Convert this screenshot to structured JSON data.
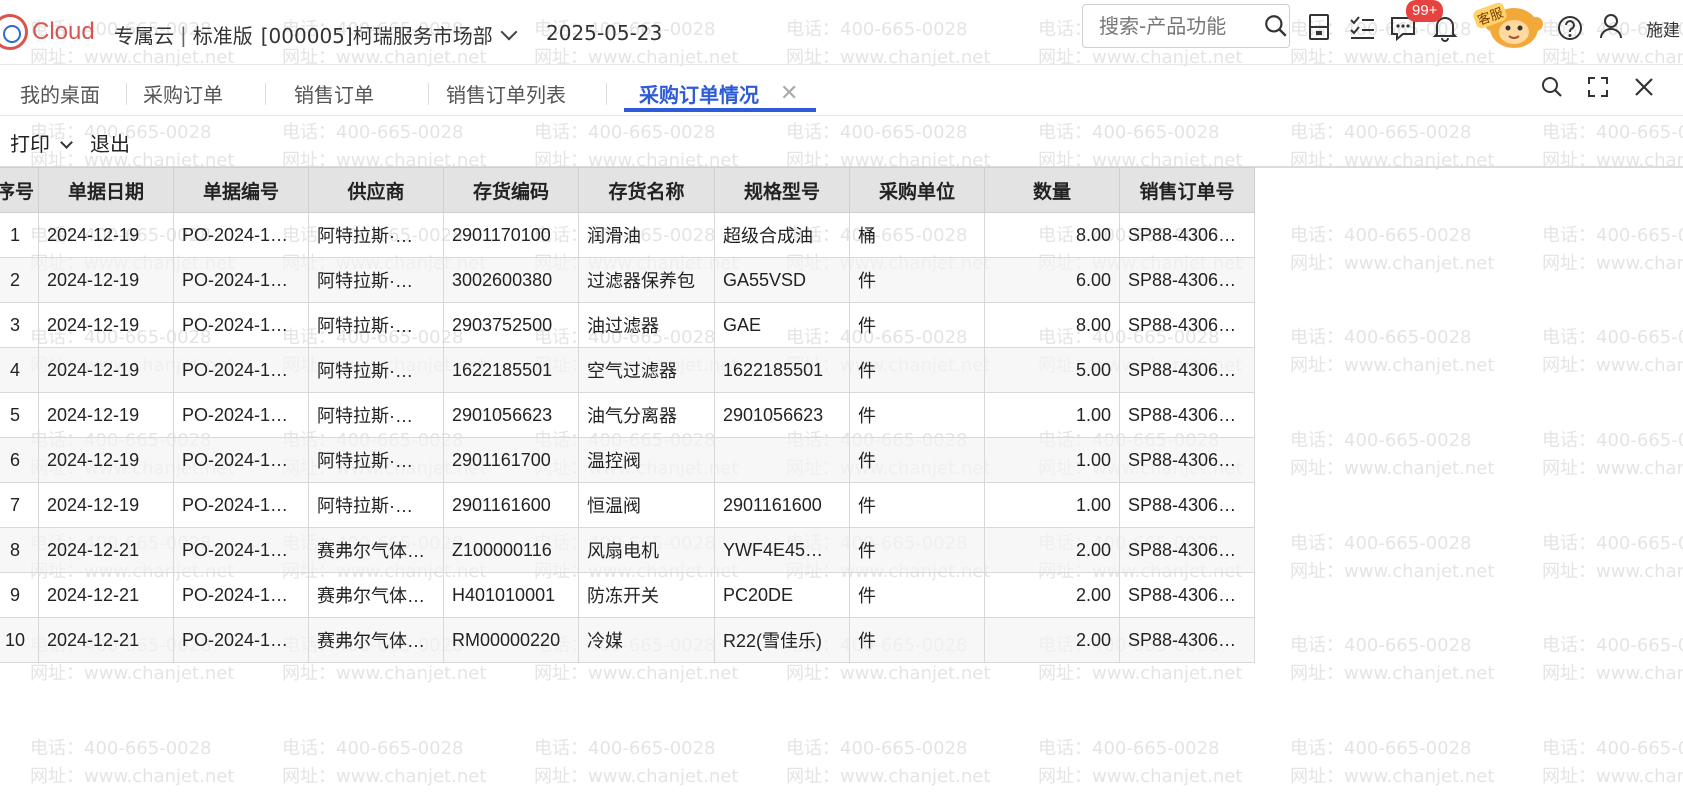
{
  "header": {
    "logo_text": "Cloud",
    "product": "专属云",
    "edition": "标准版",
    "org": "[000005]柯瑞服务市场部",
    "date": "2025-05-23",
    "search_placeholder": "搜索-产品功能",
    "badge": "99+",
    "kefu_label": "客服",
    "username": "施建"
  },
  "tabs": [
    {
      "label": "我的桌面"
    },
    {
      "label": "采购订单"
    },
    {
      "label": "销售订单"
    },
    {
      "label": "销售订单列表"
    },
    {
      "label": "采购订单情况"
    }
  ],
  "toolbar": {
    "print": "打印",
    "exit": "退出"
  },
  "watermark": {
    "line1": "电话：400-665-0028",
    "line2": "网址：www.chanjet.net"
  },
  "table": {
    "columns": [
      "序号",
      "单据日期",
      "单据编号",
      "供应商",
      "存货编码",
      "存货名称",
      "规格型号",
      "采购单位",
      "数量",
      "销售订单号"
    ],
    "rows": [
      [
        "1",
        "2024-12-19",
        "PO-2024-1…",
        "阿特拉斯·…",
        "2901170100",
        "润滑油",
        "超级合成油",
        "桶",
        "8.00",
        "SP88-4306…"
      ],
      [
        "2",
        "2024-12-19",
        "PO-2024-1…",
        "阿特拉斯·…",
        "3002600380",
        "过滤器保养包",
        "GA55VSD",
        "件",
        "6.00",
        "SP88-4306…"
      ],
      [
        "3",
        "2024-12-19",
        "PO-2024-1…",
        "阿特拉斯·…",
        "2903752500",
        "油过滤器",
        "GAE",
        "件",
        "8.00",
        "SP88-4306…"
      ],
      [
        "4",
        "2024-12-19",
        "PO-2024-1…",
        "阿特拉斯·…",
        "1622185501",
        "空气过滤器",
        "1622185501",
        "件",
        "5.00",
        "SP88-4306…"
      ],
      [
        "5",
        "2024-12-19",
        "PO-2024-1…",
        "阿特拉斯·…",
        "2901056623",
        "油气分离器",
        "2901056623",
        "件",
        "1.00",
        "SP88-4306…"
      ],
      [
        "6",
        "2024-12-19",
        "PO-2024-1…",
        "阿特拉斯·…",
        "2901161700",
        "温控阀",
        "",
        "件",
        "1.00",
        "SP88-4306…"
      ],
      [
        "7",
        "2024-12-19",
        "PO-2024-1…",
        "阿特拉斯·…",
        "2901161600",
        "恒温阀",
        "2901161600",
        "件",
        "1.00",
        "SP88-4306…"
      ],
      [
        "8",
        "2024-12-21",
        "PO-2024-1…",
        "赛弗尔气体…",
        "Z100000116",
        "风扇电机",
        "YWF4E45…",
        "件",
        "2.00",
        "SP88-4306…"
      ],
      [
        "9",
        "2024-12-21",
        "PO-2024-1…",
        "赛弗尔气体…",
        "H401010001",
        "防冻开关",
        "PC20DE",
        "件",
        "2.00",
        "SP88-4306…"
      ],
      [
        "10",
        "2024-12-21",
        "PO-2024-1…",
        "赛弗尔气体…",
        "RM00000220",
        "冷媒",
        "R22(雪佳乐)",
        "件",
        "2.00",
        "SP88-4306…"
      ]
    ]
  },
  "icons": [
    "search-icon",
    "document-icon",
    "checklist-icon",
    "message-icon",
    "bell-icon",
    "help-icon",
    "user-icon",
    "close-icon",
    "fullscreen-icon",
    "tab-search-icon"
  ],
  "colors": {
    "accent": "#2e5bd8",
    "logo": "#d9544f",
    "badge": "#e64340",
    "header_bg": "#e3e3e3"
  }
}
